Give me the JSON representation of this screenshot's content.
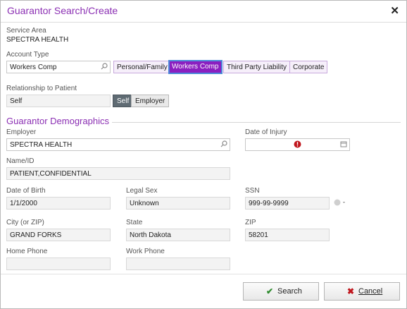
{
  "dialog": {
    "title": "Guarantor Search/Create",
    "close_glyph": "✕"
  },
  "service_area": {
    "label": "Service Area",
    "value": "SPECTRA HEALTH"
  },
  "account_type": {
    "label": "Account Type",
    "value": "Workers Comp",
    "options": [
      "Personal/Family",
      "Workers Comp",
      "Third Party Liability",
      "Corporate"
    ],
    "selected": "Workers Comp"
  },
  "relationship": {
    "label": "Relationship to Patient",
    "value": "Self",
    "options": [
      "Self",
      "Employer"
    ],
    "selected": "Self"
  },
  "demographics": {
    "heading": "Guarantor Demographics",
    "employer": {
      "label": "Employer",
      "value": "SPECTRA HEALTH"
    },
    "date_of_injury": {
      "label": "Date of Injury",
      "value": ""
    },
    "name_id": {
      "label": "Name/ID",
      "value": "PATIENT,CONFIDENTIAL"
    },
    "dob": {
      "label": "Date of Birth",
      "value": "1/1/2000"
    },
    "legal_sex": {
      "label": "Legal Sex",
      "value": "Unknown"
    },
    "ssn": {
      "label": "SSN",
      "value": "999-99-9999"
    },
    "city": {
      "label": "City (or ZIP)",
      "value": "GRAND FORKS"
    },
    "state": {
      "label": "State",
      "value": "North Dakota"
    },
    "zip": {
      "label": "ZIP",
      "value": "58201"
    },
    "home_phone": {
      "label": "Home Phone",
      "value": ""
    },
    "work_phone": {
      "label": "Work Phone",
      "value": ""
    }
  },
  "footer": {
    "search_label": "Search",
    "cancel_label": "Cancel"
  },
  "colors": {
    "accent": "#8b2fb3",
    "selected_button": "#8b1fc0",
    "error": "#c0161d",
    "ok_check": "#2e8b2e"
  }
}
